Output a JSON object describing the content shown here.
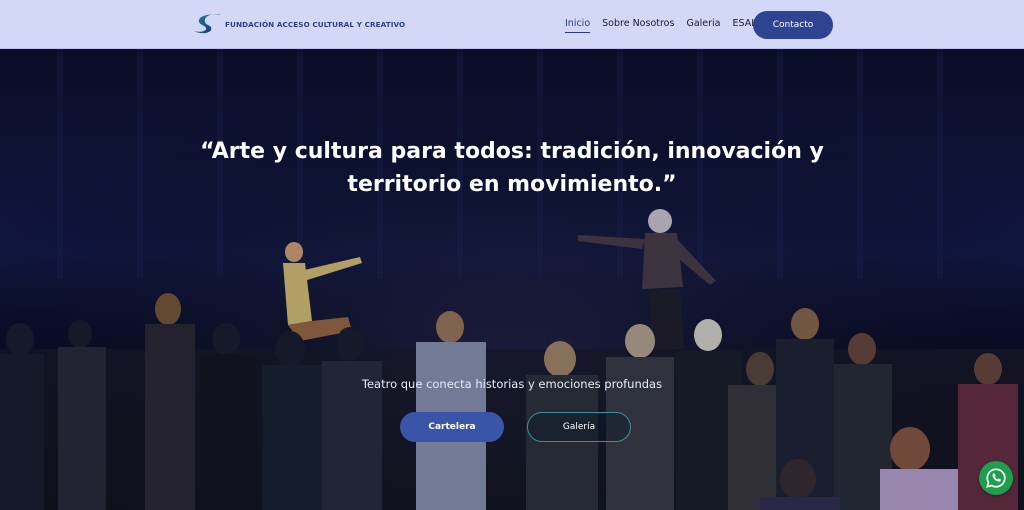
{
  "brand": {
    "name": "FUNDACIÓN ACCESO CULTURAL Y CREATIVO",
    "logo_icon": "wave-logo-icon"
  },
  "nav": {
    "items": [
      {
        "label": "Inicio",
        "active": true
      },
      {
        "label": "Sobre Nosotros",
        "active": false
      },
      {
        "label": "Galeria",
        "active": false
      },
      {
        "label": "ESAL",
        "active": false
      }
    ],
    "contact_label": "Contacto"
  },
  "hero": {
    "quote_line1": "“Arte y cultura para todos: tradición, innovación y",
    "quote_line2": "territorio en movimiento.”",
    "subtitle": "Teatro que conecta historias y emociones profundas",
    "primary_button": "Cartelera",
    "secondary_button": "Galería"
  },
  "floating": {
    "whatsapp_icon": "whatsapp-icon"
  },
  "colors": {
    "navbar_bg": "#d3d8f7",
    "accent": "#2e4392",
    "primary_button": "#3a55a8",
    "secondary_border": "#3a8f9a",
    "whatsapp": "#1f9e4d"
  }
}
